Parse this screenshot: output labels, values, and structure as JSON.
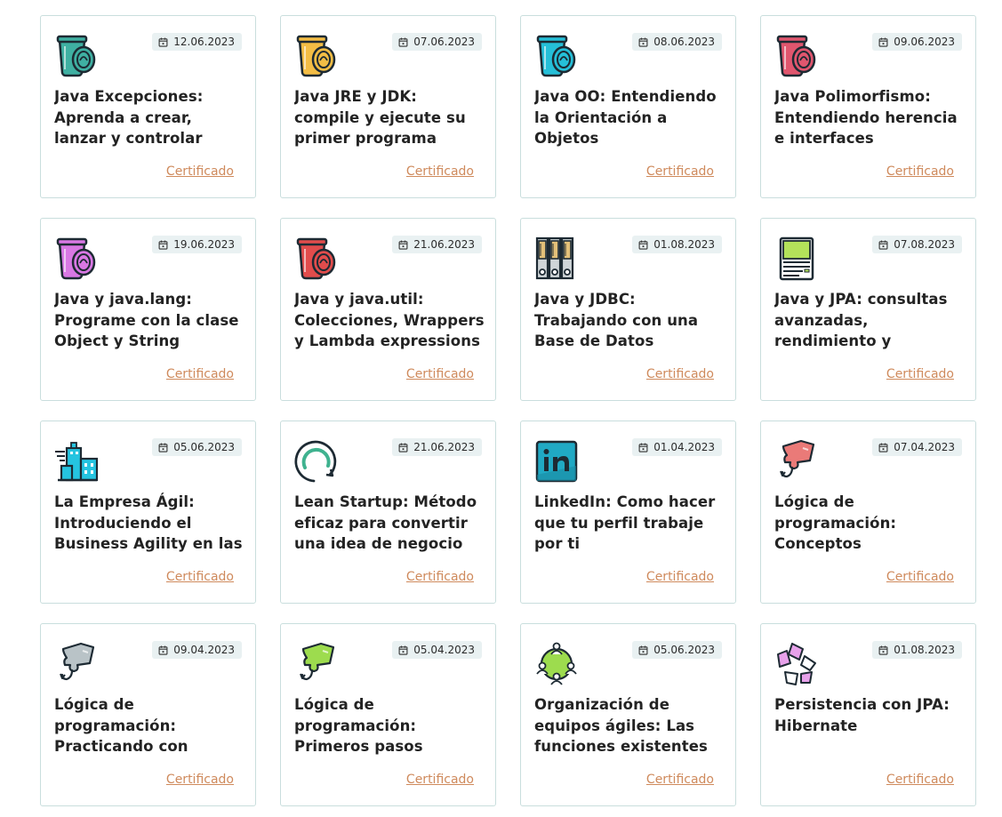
{
  "courses": [
    {
      "date": "12.06.2023",
      "title": "Java Excepciones: Aprenda a crear, lanzar y controlar excepciones",
      "cert": "Certificado",
      "icon": "cup-teal-icon",
      "color": "#3fb0a2"
    },
    {
      "date": "07.06.2023",
      "title": "Java JRE y JDK: compile y ejecute su primer programa",
      "cert": "Certificado",
      "icon": "cup-yellow-icon",
      "color": "#f3bd45"
    },
    {
      "date": "08.06.2023",
      "title": "Java OO: Entendiendo la Orientación a Objetos",
      "cert": "Certificado",
      "icon": "cup-cyan-icon",
      "color": "#25bfd8"
    },
    {
      "date": "09.06.2023",
      "title": "Java Polimorfismo: Entendiendo herencia e interfaces",
      "cert": "Certificado",
      "icon": "cup-pink-icon",
      "color": "#e0566e"
    },
    {
      "date": "19.06.2023",
      "title": "Java y java.lang: Programe con la clase Object y String",
      "cert": "Certificado",
      "icon": "cup-magenta-icon",
      "color": "#d978e4"
    },
    {
      "date": "21.06.2023",
      "title": "Java y java.util: Colecciones, Wrappers y Lambda expressions",
      "cert": "Certificado",
      "icon": "cup-red-icon",
      "color": "#e24c4c"
    },
    {
      "date": "01.08.2023",
      "title": "Java y JDBC: Trabajando con una Base de Datos",
      "cert": "Certificado",
      "icon": "binders-icon",
      "color": "#e3c079"
    },
    {
      "date": "07.08.2023",
      "title": "Java y JPA: consultas avanzadas, rendimiento y modelos complejos",
      "cert": "Certificado",
      "icon": "server-icon",
      "color": "#b4e25a"
    },
    {
      "date": "05.06.2023",
      "title": "La Empresa Ágil: Introduciendo el Business Agility en las",
      "cert": "Certificado",
      "icon": "buildings-icon",
      "color": "#25c4e0"
    },
    {
      "date": "21.06.2023",
      "title": "Lean Startup: Método eficaz para convertir una idea de negocio en",
      "cert": "Certificado",
      "icon": "cycle-icon",
      "color": "#3fb28f"
    },
    {
      "date": "01.04.2023",
      "title": "LinkedIn: Como hacer que tu perfil trabaje por ti",
      "cert": "Certificado",
      "icon": "linkedin-icon",
      "color": "#20a9c4"
    },
    {
      "date": "07.04.2023",
      "title": "Lógica de programación: Conceptos primordiales",
      "cert": "Certificado",
      "icon": "puzzle-salmon-icon",
      "color": "#ea7a78"
    },
    {
      "date": "09.04.2023",
      "title": "Lógica de programación: Practicando con juegos y animaciones",
      "cert": "Certificado",
      "icon": "puzzle-gray-icon",
      "color": "#b9c3c7"
    },
    {
      "date": "05.04.2023",
      "title": "Lógica de programación: Primeros pasos",
      "cert": "Certificado",
      "icon": "puzzle-green-icon",
      "color": "#9ddc4e"
    },
    {
      "date": "05.06.2023",
      "title": "Organización de equipos ágiles: Las funciones existentes en",
      "cert": "Certificado",
      "icon": "team-icon",
      "color": "#9ddc4e"
    },
    {
      "date": "01.08.2023",
      "title": "Persistencia con JPA: Hibernate",
      "cert": "Certificado",
      "icon": "cubes-icon",
      "color": "#e7a1ea"
    }
  ]
}
